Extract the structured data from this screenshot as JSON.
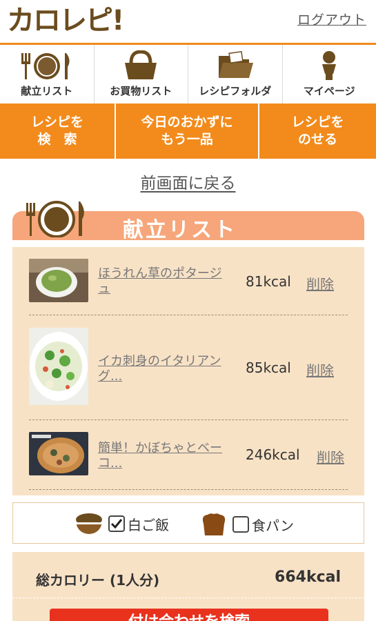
{
  "header": {
    "logo": "カロレピ!",
    "logout_label": "ログアウト"
  },
  "nav": [
    {
      "label": "献立リスト",
      "icon": "cutlery-plate-icon"
    },
    {
      "label": "お買物リスト",
      "icon": "shopping-basket-icon"
    },
    {
      "label": "レシピフォルダ",
      "icon": "folder-icon"
    },
    {
      "label": "マイページ",
      "icon": "person-icon"
    }
  ],
  "actions": [
    {
      "label": "レシピを\n検　索"
    },
    {
      "label": "今日のおかずに\nもう一品"
    },
    {
      "label": "レシピを\nのせる"
    }
  ],
  "back_label": "前画面に戻る",
  "section_title": "献立リスト",
  "recipes": [
    {
      "name": "ほうれん草のポタージュ",
      "kcal": "81kcal",
      "delete_label": "削除"
    },
    {
      "name": "イカ刺身のイタリアング...",
      "kcal": "85kcal",
      "delete_label": "削除"
    },
    {
      "name": "簡単！かぼちゃとベーコ...",
      "kcal": "246kcal",
      "delete_label": "削除"
    }
  ],
  "staples": [
    {
      "label": "白ご飯",
      "checked": true,
      "icon": "rice-bowl-icon"
    },
    {
      "label": "食パン",
      "checked": false,
      "icon": "bread-icon"
    }
  ],
  "total": {
    "label": "総カロリー (1人分)",
    "value": "664kcal"
  },
  "search_button_label": "付け合わせを検索",
  "colors": {
    "brand_orange": "#f28b1c",
    "banner": "#f6a67a",
    "panel": "#f8e2c6",
    "search_button": "#e8321e",
    "logo_brown": "#6b4c1e"
  }
}
